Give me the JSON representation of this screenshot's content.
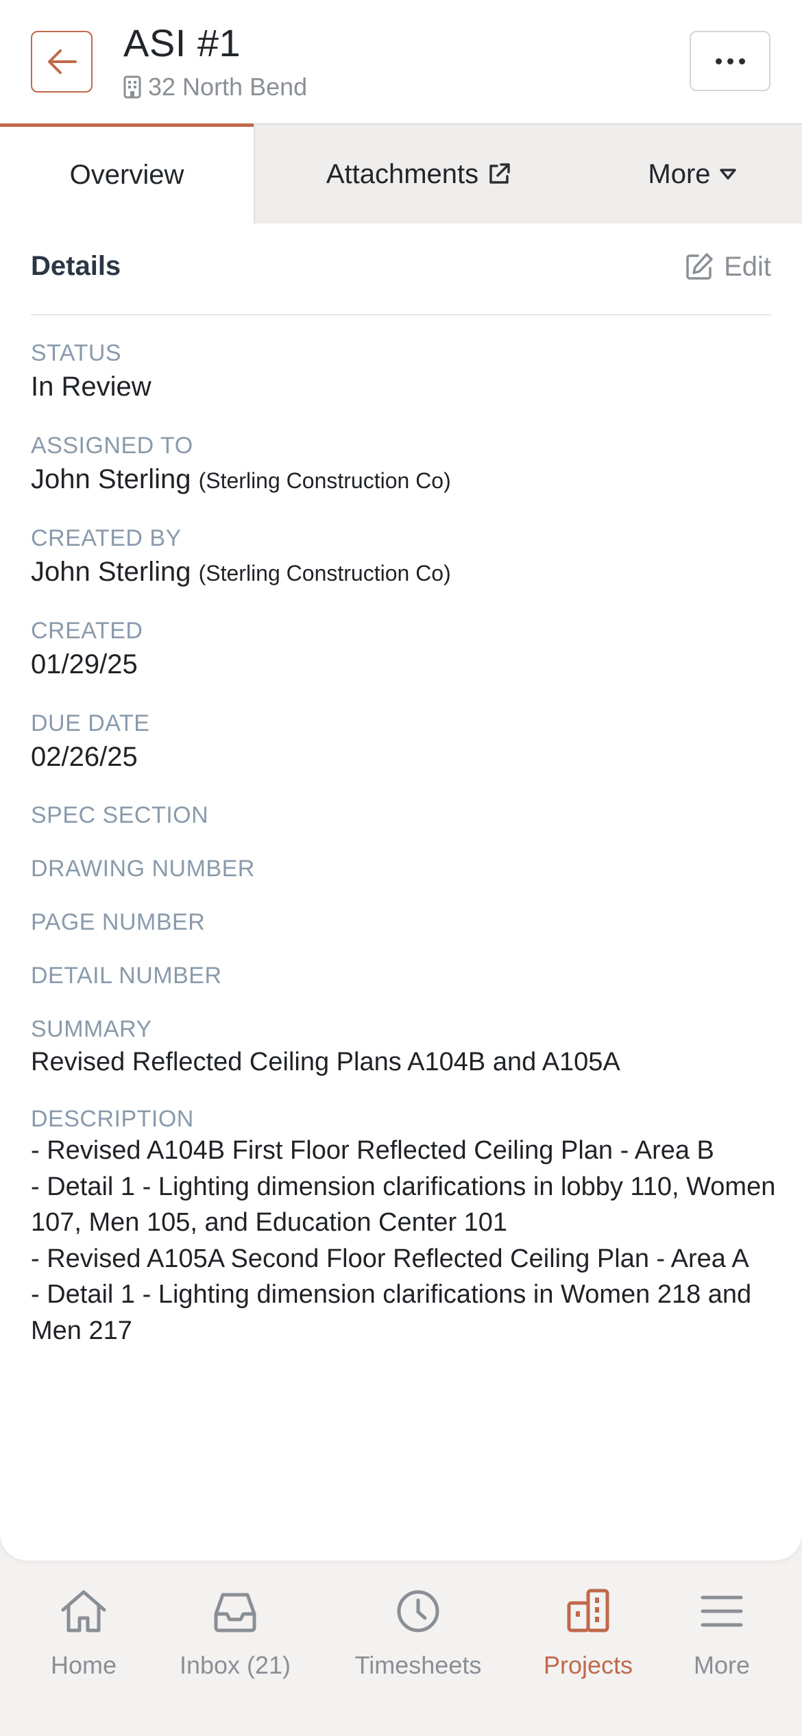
{
  "colors": {
    "accent": "#c0694a",
    "label": "#8a9aab",
    "muted": "#8a8f95"
  },
  "header": {
    "title": "ASI #1",
    "subtitle": "32 North Bend",
    "back_icon": "arrow-left-icon",
    "menu_icon": "ellipsis-icon"
  },
  "tabs": [
    {
      "label": "Overview",
      "active": true
    },
    {
      "label": "Attachments",
      "icon": "external-link-icon"
    },
    {
      "label": "More",
      "icon": "caret-down-icon"
    }
  ],
  "details": {
    "title": "Details",
    "edit_label": "Edit",
    "fields": {
      "status": {
        "label": "STATUS",
        "value": "In Review"
      },
      "assigned_to": {
        "label": "ASSIGNED TO",
        "name": "John Sterling",
        "org": "(Sterling Construction Co)"
      },
      "created_by": {
        "label": "CREATED BY",
        "name": "John Sterling",
        "org": "(Sterling Construction Co)"
      },
      "created": {
        "label": "CREATED",
        "value": "01/29/25"
      },
      "due_date": {
        "label": "DUE DATE",
        "value": "02/26/25"
      },
      "spec_section": {
        "label": "SPEC SECTION"
      },
      "drawing_number": {
        "label": "DRAWING NUMBER"
      },
      "page_number": {
        "label": "PAGE NUMBER"
      },
      "detail_number": {
        "label": "DETAIL NUMBER"
      },
      "summary": {
        "label": "SUMMARY",
        "value": "Revised Reflected Ceiling Plans A104B and A105A"
      },
      "description": {
        "label": "DESCRIPTION",
        "lines": [
          "- Revised A104B First Floor Reflected Ceiling Plan - Area B",
          "- Detail 1 - Lighting dimension clarifications in lobby 110, Women 107, Men 105, and Education Center 101",
          "- Revised A105A Second Floor Reflected Ceiling Plan - Area A",
          "- Detail 1 - Lighting dimension clarifications in Women 218 and Men 217"
        ]
      }
    }
  },
  "bottom_nav": [
    {
      "label": "Home",
      "icon": "home-icon"
    },
    {
      "label": "Inbox (21)",
      "icon": "inbox-icon"
    },
    {
      "label": "Timesheets",
      "icon": "clock-icon"
    },
    {
      "label": "Projects",
      "icon": "buildings-icon",
      "active": true
    },
    {
      "label": "More",
      "icon": "hamburger-icon"
    }
  ]
}
